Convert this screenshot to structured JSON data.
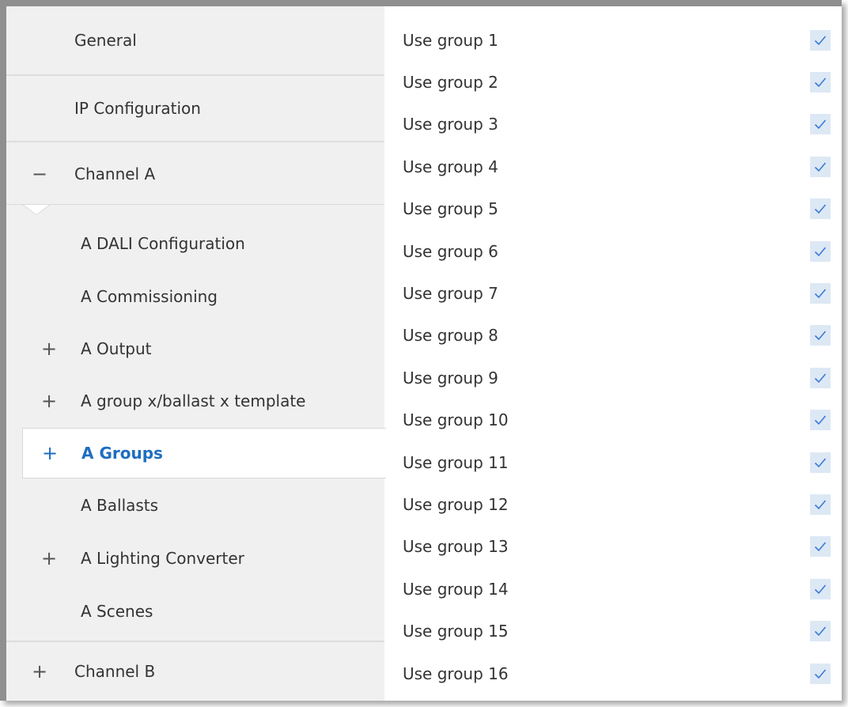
{
  "sidebar": {
    "items": [
      {
        "label": "General",
        "expander": ""
      },
      {
        "label": "IP Configuration",
        "expander": ""
      },
      {
        "label": "Channel A",
        "expander": "−"
      },
      {
        "label": "A DALI Configuration",
        "expander": ""
      },
      {
        "label": "A Commissioning",
        "expander": ""
      },
      {
        "label": "A Output",
        "expander": "+"
      },
      {
        "label": "A group x/ballast x template",
        "expander": "+"
      },
      {
        "label": "A Groups",
        "expander": "+"
      },
      {
        "label": "A Ballasts",
        "expander": ""
      },
      {
        "label": "A Lighting Converter",
        "expander": "+"
      },
      {
        "label": "A Scenes",
        "expander": ""
      },
      {
        "label": "Channel B",
        "expander": "+"
      }
    ],
    "active_item": "A Groups"
  },
  "parameters": {
    "rows": [
      {
        "label": "Use group 1",
        "checked": true
      },
      {
        "label": "Use group 2",
        "checked": true
      },
      {
        "label": "Use group 3",
        "checked": true
      },
      {
        "label": "Use group 4",
        "checked": true
      },
      {
        "label": "Use group 5",
        "checked": true
      },
      {
        "label": "Use group 6",
        "checked": true
      },
      {
        "label": "Use group 7",
        "checked": true
      },
      {
        "label": "Use group 8",
        "checked": true
      },
      {
        "label": "Use group 9",
        "checked": true
      },
      {
        "label": "Use group 10",
        "checked": true
      },
      {
        "label": "Use group 11",
        "checked": true
      },
      {
        "label": "Use group 12",
        "checked": true
      },
      {
        "label": "Use group 13",
        "checked": true
      },
      {
        "label": "Use group 14",
        "checked": true
      },
      {
        "label": "Use group 15",
        "checked": true
      },
      {
        "label": "Use group 16",
        "checked": true
      }
    ]
  },
  "colors": {
    "accent": "#1e6ec0",
    "sidebar_bg": "#f0f0f0",
    "checkbox_bg": "#dde8f5",
    "check_mark": "#3a7bd5"
  },
  "icons": {
    "check": "check-icon",
    "expand": "plus-icon",
    "collapse": "minus-icon"
  }
}
